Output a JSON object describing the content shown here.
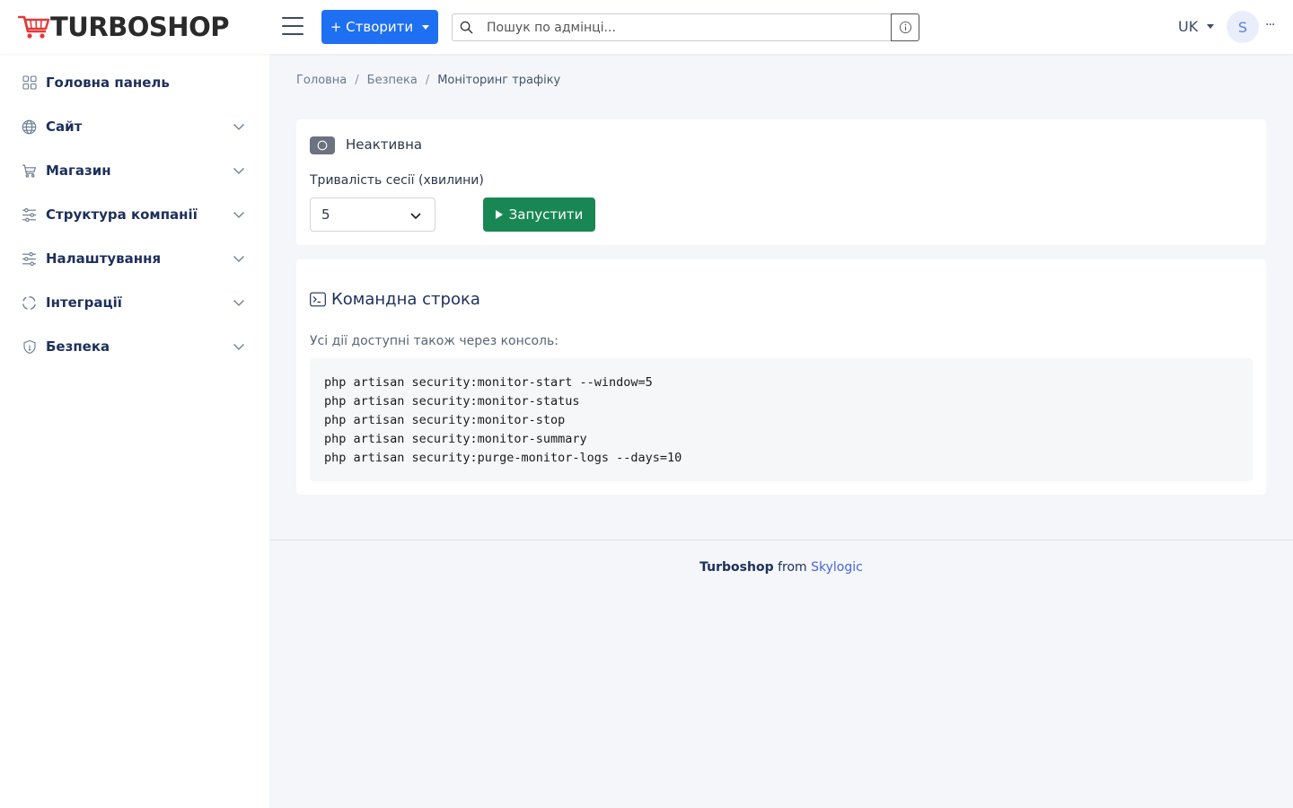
{
  "header": {
    "logo_text": "TURBOSHOP",
    "create_label": "+ Створити",
    "search_placeholder": "Пошук по адмінці...",
    "lang": "UK",
    "avatar_initial": "S",
    "more": "···",
    "accent": "#1e6ff2"
  },
  "sidebar": {
    "items": [
      {
        "label": "Головна панель",
        "icon": "dashboard-icon",
        "has_children": false
      },
      {
        "label": "Сайт",
        "icon": "globe-icon",
        "has_children": true
      },
      {
        "label": "Магазин",
        "icon": "cart-icon",
        "has_children": true
      },
      {
        "label": "Структура компанії",
        "icon": "sliders-icon",
        "has_children": true
      },
      {
        "label": "Налаштування",
        "icon": "settings-sliders-icon",
        "has_children": true
      },
      {
        "label": "Інтеграції",
        "icon": "integrations-icon",
        "has_children": true
      },
      {
        "label": "Безпека",
        "icon": "shield-icon",
        "has_children": true
      }
    ]
  },
  "breadcrumb": {
    "items": [
      "Головна",
      "Безпека"
    ],
    "current": "Моніторинг трафіку"
  },
  "monitor": {
    "status": "Неактивна",
    "duration_label": "Тривалість сесії (хвилини)",
    "duration_value": "5",
    "run_label": "Запустити",
    "run_color": "#198754"
  },
  "cli": {
    "title": "Командна строка",
    "description": "Усі дії доступні також через консоль:",
    "commands": [
      "php artisan security:monitor-start --window=5",
      "php artisan security:monitor-status",
      "php artisan security:monitor-stop",
      "php artisan security:monitor-summary",
      "php artisan security:purge-monitor-logs --days=10"
    ]
  },
  "footer": {
    "brand": "Turboshop",
    "from": "from",
    "company": "Skylogic"
  }
}
